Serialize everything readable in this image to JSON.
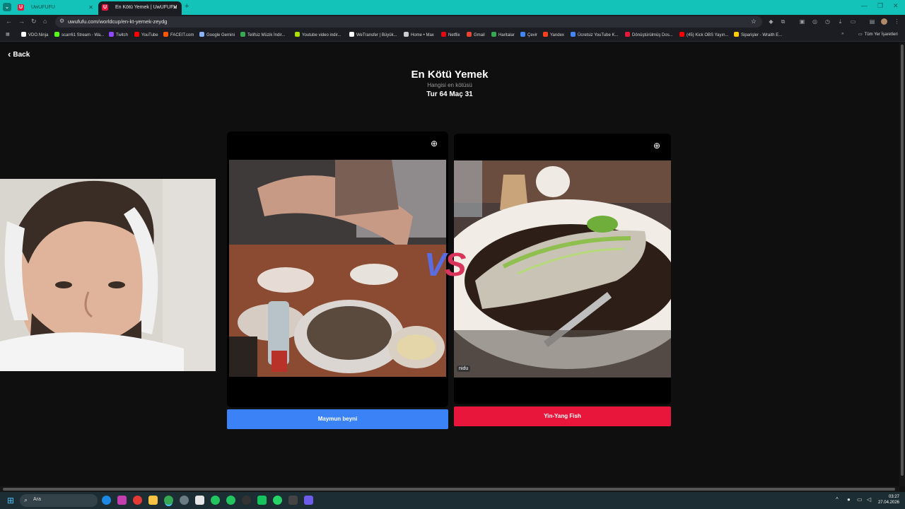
{
  "browser": {
    "tabs": [
      {
        "title": "UwUFUFU",
        "active": false
      },
      {
        "title": "En Kötü Yemek | UwUFUFU",
        "active": true
      }
    ],
    "url": "uwufufu.com/worldcup/en-kt-yemek-zeydg",
    "bookmarks": [
      {
        "label": "VDO.Ninja",
        "color": "#ffffff"
      },
      {
        "label": "scarr61 Stream - Wa...",
        "color": "#53fc18"
      },
      {
        "label": "Twitch",
        "color": "#9146ff"
      },
      {
        "label": "YouTube",
        "color": "#ff0000"
      },
      {
        "label": "FACEIT.com",
        "color": "#ff5500"
      },
      {
        "label": "Google Gemini",
        "color": "#8ab4f8"
      },
      {
        "label": "Telifsiz Müzik İndir...",
        "color": "#34a853"
      },
      {
        "label": "Youtube video indir...",
        "color": "#aadd00"
      },
      {
        "label": "WeTransfer | Büyük...",
        "color": "#ffffff"
      },
      {
        "label": "Home • Max",
        "color": "#cccccc"
      },
      {
        "label": "Netflix",
        "color": "#e50914"
      },
      {
        "label": "Gmail",
        "color": "#ea4335"
      },
      {
        "label": "Haritalar",
        "color": "#34a853"
      },
      {
        "label": "Çevir",
        "color": "#4285f4"
      },
      {
        "label": "Yandex",
        "color": "#fc3f1d"
      },
      {
        "label": "Ücretsiz YouTube K...",
        "color": "#4285f4"
      },
      {
        "label": "Dönüştürülmüş Dos...",
        "color": "#e8163a"
      },
      {
        "label": "(45) Kick OBS Yayın...",
        "color": "#ff0000"
      },
      {
        "label": "Siparişler - Wraith E...",
        "color": "#ffcc00"
      }
    ],
    "all_bookmarks_label": "Tüm Yer İşaretleri"
  },
  "page": {
    "back_label": "Back",
    "title": "En Kötü Yemek",
    "subtitle": "Hangisi en kötüsü",
    "round": "Tur 64 Maç 31",
    "vs_v": "V",
    "vs_s": "S",
    "left_choice": {
      "label": "Maymun beyni"
    },
    "right_choice": {
      "label": "Yin-Yang Fish",
      "watermark": "nidu"
    }
  },
  "taskbar": {
    "search_label": "Ara",
    "time": "03:27",
    "date": "27.04.2026"
  }
}
